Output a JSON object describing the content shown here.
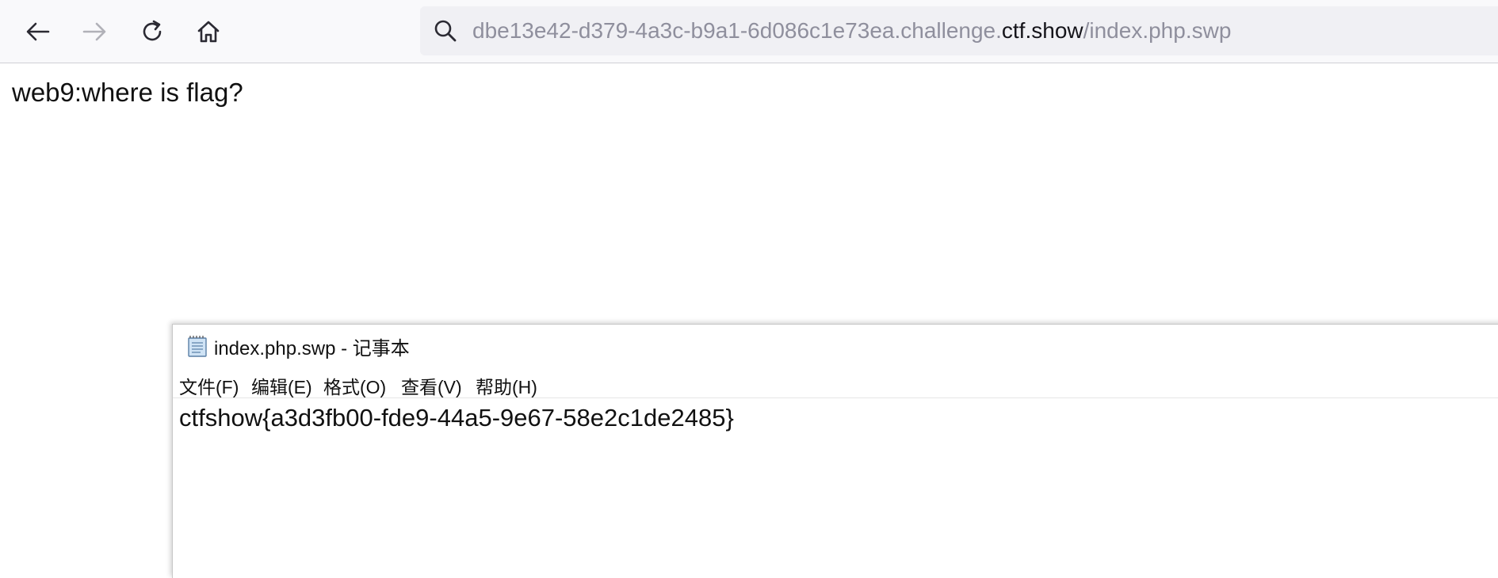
{
  "browser": {
    "url": {
      "prefix": "dbe13e42-d379-4a3c-b9a1-6d086c1e73ea.challenge.",
      "domain": "ctf.show",
      "path": "/index.php.swp"
    },
    "icons": {
      "back": "arrow-left-icon",
      "forward": "arrow-right-icon",
      "reload": "reload-icon",
      "home": "home-icon",
      "search": "search-icon"
    }
  },
  "page": {
    "text": "web9:where is flag?"
  },
  "notepad": {
    "title": "index.php.swp - 记事本",
    "menu": [
      {
        "label": "文件(F)"
      },
      {
        "label": "编辑(E)"
      },
      {
        "label": "格式(O)"
      },
      {
        "label": "查看(V)"
      },
      {
        "label": "帮助(H)"
      }
    ],
    "content": "ctfshow{a3d3fb00-fde9-44a5-9e67-58e2c1de2485}"
  },
  "colors": {
    "toolbar_bg": "#f9f9fb",
    "urlbar_bg": "#f0f0f4",
    "url_dim": "#8f8f9d",
    "url_domain": "#15141a"
  }
}
